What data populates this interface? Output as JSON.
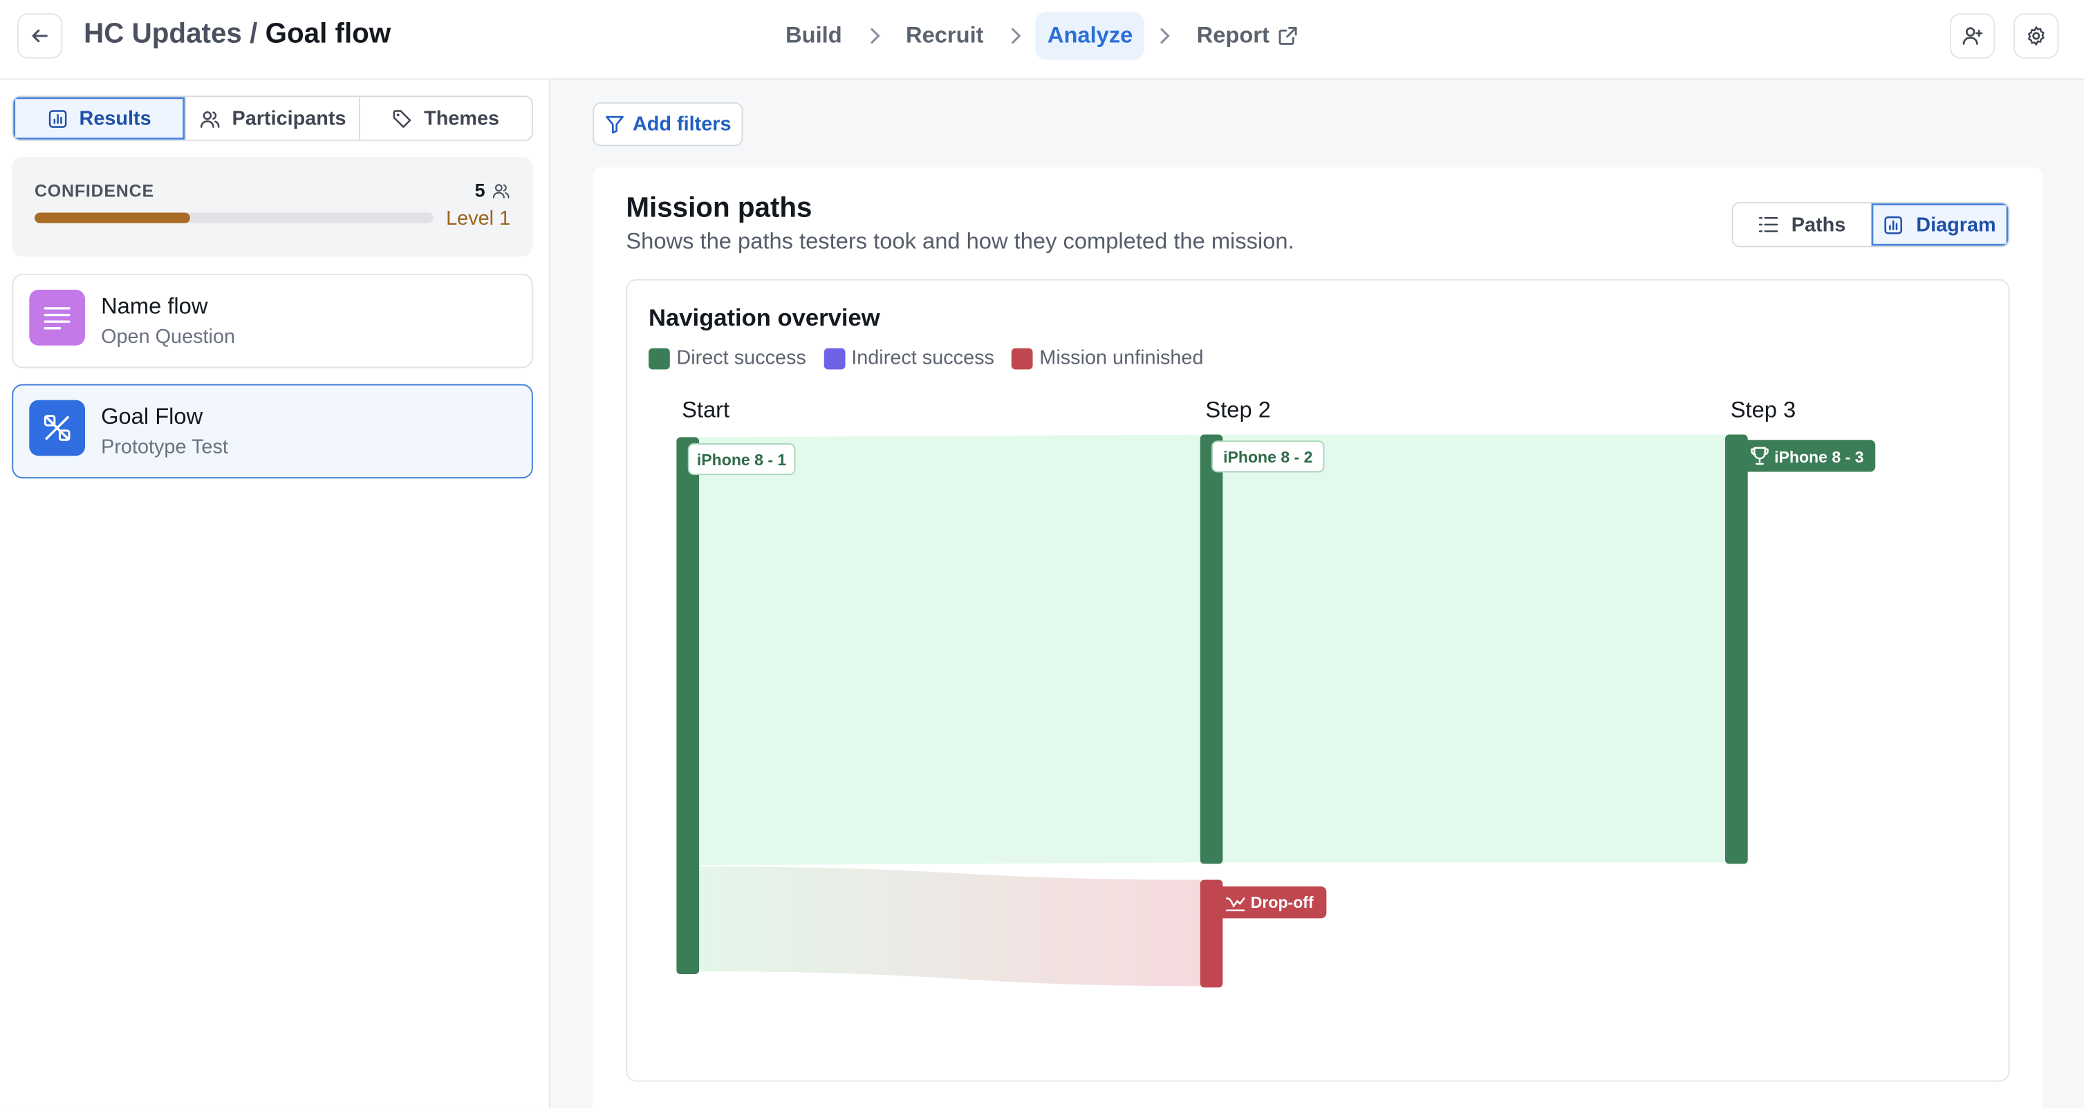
{
  "header": {
    "project": "HC Updates",
    "separator": " / ",
    "page": "Goal flow",
    "steps": [
      {
        "label": "Build",
        "active": false
      },
      {
        "label": "Recruit",
        "active": false
      },
      {
        "label": "Analyze",
        "active": true
      },
      {
        "label": "Report",
        "active": false,
        "external": true
      }
    ]
  },
  "sidebar": {
    "tabs": [
      {
        "label": "Results",
        "icon": "bar-chart-icon",
        "active": true
      },
      {
        "label": "Participants",
        "icon": "users-icon",
        "active": false
      },
      {
        "label": "Themes",
        "icon": "tag-icon",
        "active": false
      }
    ],
    "confidence": {
      "label": "CONFIDENCE",
      "count": "5",
      "level": "Level 1",
      "progress": 0.39,
      "color": "#a86c26"
    },
    "questions": [
      {
        "title": "Name flow",
        "subtitle": "Open Question",
        "icon": "text-lines-icon",
        "color": "#c37ae8",
        "active": false
      },
      {
        "title": "Goal Flow",
        "subtitle": "Prototype Test",
        "icon": "prototype-icon",
        "color": "#2f6de0",
        "active": true
      }
    ]
  },
  "main": {
    "filter_label": "Add filters",
    "mission": {
      "title": "Mission paths",
      "description": "Shows the paths testers took and how they completed the mission."
    },
    "view_toggle": [
      {
        "label": "Paths",
        "icon": "list-icon",
        "active": false
      },
      {
        "label": "Diagram",
        "icon": "bar-chart-icon",
        "active": true
      }
    ],
    "navigation": {
      "title": "Navigation overview",
      "legend": [
        {
          "label": "Direct success",
          "color": "#3b7d57"
        },
        {
          "label": "Indirect success",
          "color": "#6e63e6"
        },
        {
          "label": "Mission unfinished",
          "color": "#c0474f"
        }
      ],
      "steps": [
        "Start",
        "Step 2",
        "Step 3"
      ],
      "nodes": [
        {
          "label": "iPhone 8 - 1"
        },
        {
          "label": "iPhone 8 - 2"
        },
        {
          "label": "iPhone 8 - 3"
        },
        {
          "label": "Drop-off"
        }
      ]
    }
  }
}
